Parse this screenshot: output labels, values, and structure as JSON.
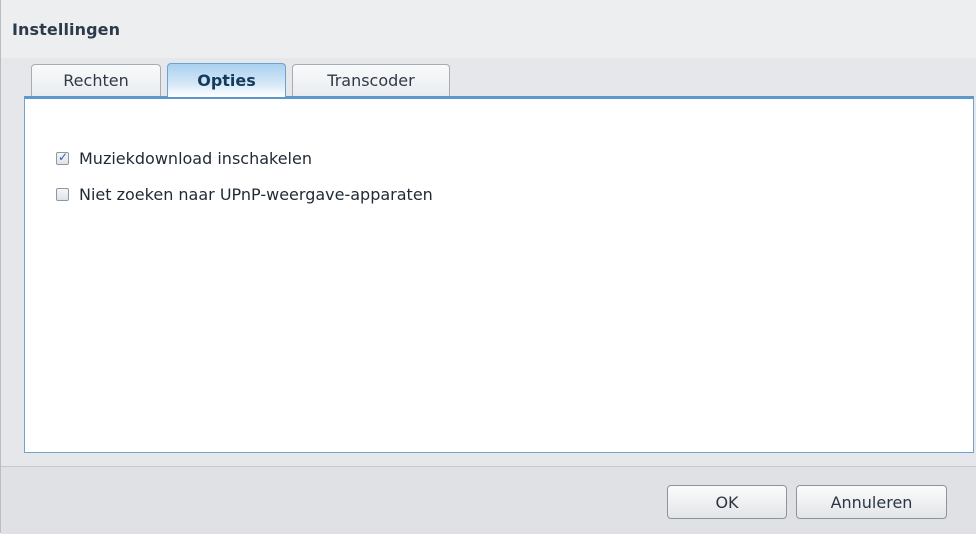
{
  "dialog": {
    "title": "Instellingen"
  },
  "tabs": [
    {
      "label": "Rechten",
      "active": false
    },
    {
      "label": "Opties",
      "active": true
    },
    {
      "label": "Transcoder",
      "active": false
    }
  ],
  "options": [
    {
      "label": "Muziekdownload inschakelen",
      "checked": true
    },
    {
      "label": "Niet zoeken naar UPnP-weergave-apparaten",
      "checked": false
    }
  ],
  "footer": {
    "ok_label": "OK",
    "cancel_label": "Annuleren"
  },
  "colors": {
    "active_tab": "#a9d0ef",
    "panel_border": "#5e97cb",
    "title_text": "#2d3a4a"
  }
}
